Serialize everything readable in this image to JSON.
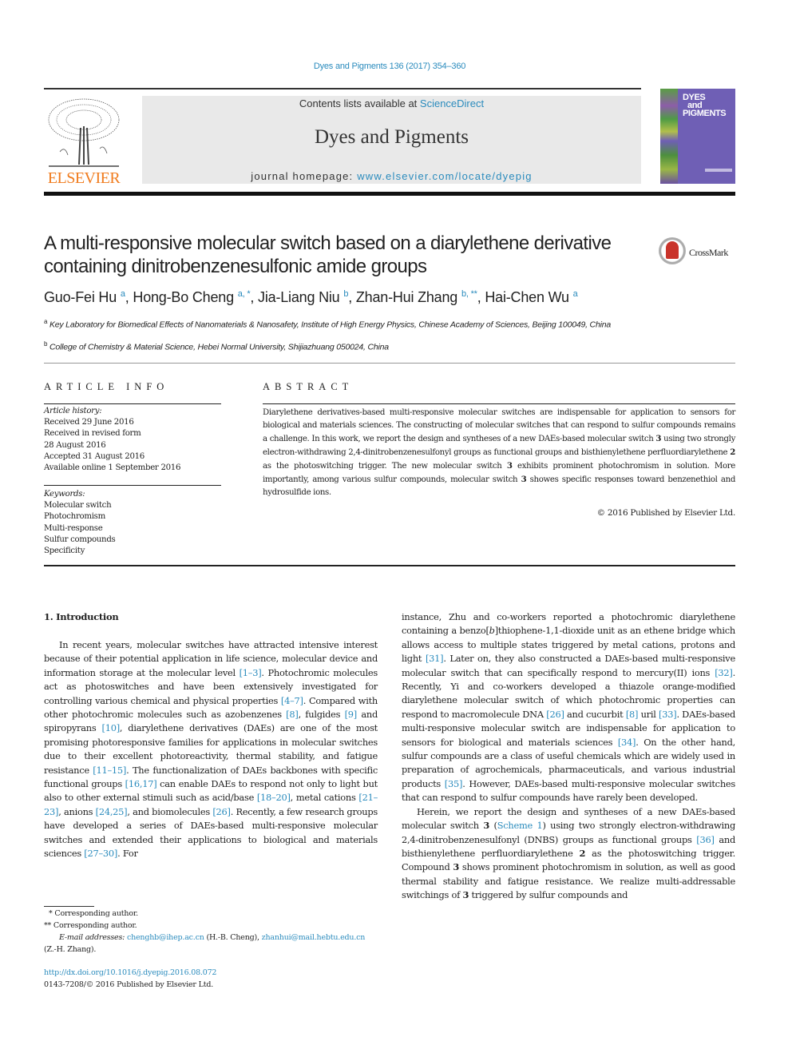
{
  "header": {
    "citation": "Dyes and Pigments 136 (2017) 354–360",
    "publisher_wordmark": "ELSEVIER",
    "contents_prefix": "Contents lists available at ",
    "contents_link": "ScienceDirect",
    "journal_title": "Dyes and Pigments",
    "homepage_prefix": "journal homepage: ",
    "homepage_link": "www.elsevier.com/locate/dyepig",
    "cover_title_lines": [
      "DYES",
      "and",
      "PIGMENTS"
    ],
    "crossmark_label": "CrossMark"
  },
  "article": {
    "title": "A multi-responsive molecular switch based on a diarylethene derivative containing dinitrobenzenesulfonic amide groups",
    "authors": [
      {
        "name": "Guo-Fei Hu",
        "sup": "a"
      },
      {
        "name": "Hong-Bo Cheng",
        "sup": "a, *"
      },
      {
        "name": "Jia-Liang Niu",
        "sup": "b"
      },
      {
        "name": "Zhan-Hui Zhang",
        "sup": "b, **"
      },
      {
        "name": "Hai-Chen Wu",
        "sup": "a"
      }
    ],
    "affiliations": [
      {
        "mark": "a",
        "text": "Key Laboratory for Biomedical Effects of Nanomaterials & Nanosafety, Institute of High Energy Physics, Chinese Academy of Sciences, Beijing 100049, China"
      },
      {
        "mark": "b",
        "text": "College of Chemistry & Material Science, Hebei Normal University, Shijiazhuang 050024, China"
      }
    ]
  },
  "article_info": {
    "heading": "ARTICLE INFO",
    "history_label": "Article history:",
    "history": [
      "Received 29 June 2016",
      "Received in revised form",
      "28 August 2016",
      "Accepted 31 August 2016",
      "Available online 1 September 2016"
    ],
    "keywords_label": "Keywords:",
    "keywords": [
      "Molecular switch",
      "Photochromism",
      "Multi-response",
      "Sulfur compounds",
      "Specificity"
    ]
  },
  "abstract": {
    "heading": "ABSTRACT",
    "parts": [
      "Diarylethene derivatives-based multi-responsive molecular switches are indispensable for application to sensors for biological and materials sciences. The constructing of molecular switches that can respond to sulfur compounds remains a challenge. In this work, we report the design and syntheses of a new DAEs-based molecular switch ",
      "3",
      " using two strongly electron-withdrawing 2,4-dinitrobenzenesulfonyl groups as functional groups and bisthienylethene perfluordiarylethene ",
      "2",
      " as the photoswitching trigger. The new molecular switch ",
      "3",
      " exhibits prominent photochromism in solution. More importantly, among various sulfur compounds, molecular switch ",
      "3",
      " showes specific responses toward benzenethiol and hydrosulfide ions."
    ],
    "copyright": "© 2016 Published by Elsevier Ltd."
  },
  "introduction": {
    "heading": "1.  Introduction",
    "left_paragraph": [
      {
        "t": "In recent years, molecular switches have attracted intensive interest because of their potential application in life science, molecular device and information storage at the molecular level "
      },
      {
        "ref": "[1–3]"
      },
      {
        "t": ". Photochromic molecules act as photoswitches and have been extensively investigated for controlling various chemical and physical properties "
      },
      {
        "ref": "[4–7]"
      },
      {
        "t": ". Compared with other photochromic molecules such as azobenzenes "
      },
      {
        "ref": "[8]"
      },
      {
        "t": ", fulgides "
      },
      {
        "ref": "[9]"
      },
      {
        "t": " and spiropyrans "
      },
      {
        "ref": "[10]"
      },
      {
        "t": ", diarylethene derivatives (DAEs) are one of the most promising photoresponsive families for applications in molecular switches due to their excellent photoreactivity, thermal stability, and fatigue resistance "
      },
      {
        "ref": "[11–15]"
      },
      {
        "t": ". The functionalization of DAEs backbones with specific functional groups "
      },
      {
        "ref": "[16,17]"
      },
      {
        "t": " can enable DAEs to respond not only to light but also to other external stimuli such as acid/base "
      },
      {
        "ref": "[18–20]"
      },
      {
        "t": ", metal cations "
      },
      {
        "ref": "[21–23]"
      },
      {
        "t": ", anions "
      },
      {
        "ref": "[24,25]"
      },
      {
        "t": ", and biomolecules "
      },
      {
        "ref": "[26]"
      },
      {
        "t": ". Recently, a few research groups have developed a series of DAEs-based multi-responsive molecular switches and extended their applications to biological and materials sciences "
      },
      {
        "ref": "[27–30]"
      },
      {
        "t": ". For"
      }
    ],
    "right_paragraph_1": [
      {
        "t": "instance, Zhu and co-workers reported a photochromic diarylethene containing a benzo["
      },
      {
        "i": "b"
      },
      {
        "t": "]thiophene-1,1-dioxide unit as an ethene bridge which allows access to multiple states triggered by metal cations, protons and light "
      },
      {
        "ref": "[31]"
      },
      {
        "t": ". Later on, they also constructed a DAEs-based multi-responsive molecular switch that can specifically respond to mercury(II) ions "
      },
      {
        "ref": "[32]"
      },
      {
        "t": ". Recently, Yi and co-workers developed a thiazole orange-modified diarylethene molecular switch of which photochromic properties can respond to macromolecule DNA "
      },
      {
        "ref": "[26]"
      },
      {
        "t": " and cucurbit "
      },
      {
        "ref": "[8]"
      },
      {
        "t": " uril "
      },
      {
        "ref": "[33]"
      },
      {
        "t": ". DAEs-based multi-responsive molecular switch are indispensable for application to sensors for biological and materials sciences "
      },
      {
        "ref": "[34]"
      },
      {
        "t": ". On the other hand, sulfur compounds are a class of useful chemicals which are widely used in preparation of agrochemicals, pharmaceuticals, and various industrial products "
      },
      {
        "ref": "[35]"
      },
      {
        "t": ". However, DAEs-based multi-responsive molecular switches that can respond to sulfur compounds have rarely been developed."
      }
    ],
    "right_paragraph_2": [
      {
        "t": "Herein, we report the design and syntheses of a new DAEs-based molecular switch "
      },
      {
        "b": "3"
      },
      {
        "t": " ("
      },
      {
        "ref": "Scheme 1"
      },
      {
        "t": ") using two strongly electron-withdrawing 2,4-dinitrobenzenesulfonyl (DNBS) groups as functional groups "
      },
      {
        "ref": "[36]"
      },
      {
        "t": " and bisthienylethene perfluordiarylethene "
      },
      {
        "b": "2"
      },
      {
        "t": " as the photoswitching trigger. Compound "
      },
      {
        "b": "3"
      },
      {
        "t": " shows prominent photochromism in solution, as well as good thermal stability and fatigue resistance. We realize multi-addressable switchings of "
      },
      {
        "b": "3"
      },
      {
        "t": " triggered by sulfur compounds and"
      }
    ]
  },
  "footnotes": {
    "corr1": "*  Corresponding author.",
    "corr2": "**  Corresponding author.",
    "email_label": "E-mail addresses: ",
    "email1": "chenghb@ihep.ac.cn",
    "email1_owner": " (H.-B. Cheng), ",
    "email2": "zhanhui@mail.hebtu.edu.cn",
    "email2_owner": " (Z.-H. Zhang).",
    "doi": "http://dx.doi.org/10.1016/j.dyepig.2016.08.072",
    "issn": "0143-7208/© 2016 Published by Elsevier Ltd."
  },
  "colors": {
    "link": "#2a8bbd",
    "elsevier_orange": "#f07b1d",
    "banner_bg": "#e9e9e9",
    "cover_purple": "#6f5fb5",
    "crossmark_red": "#c9332a"
  }
}
